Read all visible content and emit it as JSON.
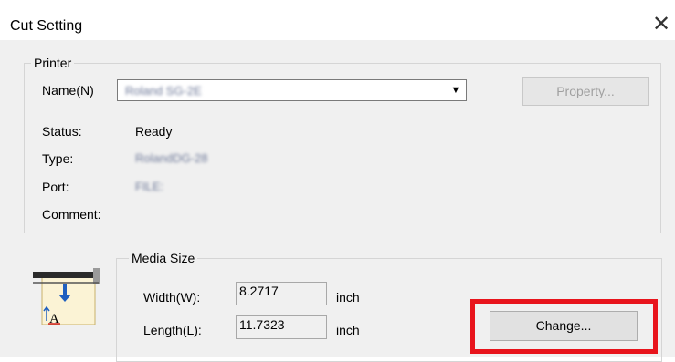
{
  "window": {
    "title": "Cut Setting",
    "close_glyph": "✕"
  },
  "printer": {
    "group_label": "Printer",
    "name_label": "Name(N)",
    "name_value": "Roland SG-2E",
    "property_button": "Property...",
    "status_label": "Status:",
    "status_value": "Ready",
    "type_label": "Type:",
    "type_value": "RolandDG-28",
    "port_label": "Port:",
    "port_value": "FILE:",
    "comment_label": "Comment:",
    "comment_value": ""
  },
  "media": {
    "group_label": "Media Size",
    "width_label": "Width(W):",
    "width_value": "8.2717",
    "width_unit": "inch",
    "length_label": "Length(L):",
    "length_value": "11.7323",
    "length_unit": "inch",
    "change_button": "Change...",
    "icon_text": "A"
  },
  "colors": {
    "highlight": "#e8141c",
    "icon_arrow": "#1f5fbf"
  }
}
